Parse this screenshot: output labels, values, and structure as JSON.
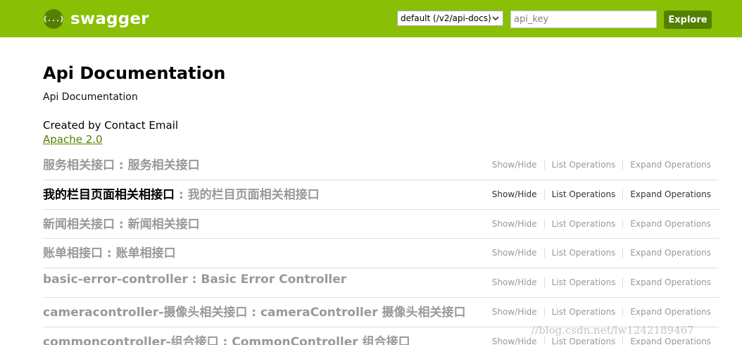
{
  "header": {
    "logo_text": "swagger",
    "logo_glyph": "{...}",
    "spec_select_value": "default (/v2/api-docs)",
    "api_key_placeholder": "api_key",
    "explore_label": "Explore"
  },
  "info": {
    "title": "Api Documentation",
    "description": "Api Documentation",
    "contact": "Created by Contact Email",
    "license": "Apache 2.0"
  },
  "resources": [
    {
      "name": "服务相关接口",
      "separator": " : ",
      "desc": "服务相关接口",
      "show_hide": "Show/Hide",
      "list_ops": "List Operations",
      "expand_ops": "Expand Operations"
    },
    {
      "name": "我的栏目页面相关相接口",
      "separator": " : ",
      "desc": "我的栏目页面相关相接口",
      "show_hide": "Show/Hide",
      "list_ops": "List Operations",
      "expand_ops": "Expand Operations"
    },
    {
      "name": "新闻相关接口",
      "separator": " : ",
      "desc": "新闻相关接口",
      "show_hide": "Show/Hide",
      "list_ops": "List Operations",
      "expand_ops": "Expand Operations"
    },
    {
      "name": "账单相接口",
      "separator": " : ",
      "desc": "账单相接口",
      "show_hide": "Show/Hide",
      "list_ops": "List Operations",
      "expand_ops": "Expand Operations"
    },
    {
      "name": "basic-error-controller",
      "separator": " : ",
      "desc": "Basic Error Controller",
      "show_hide": "Show/Hide",
      "list_ops": "List Operations",
      "expand_ops": "Expand Operations"
    },
    {
      "name": "cameracontroller-摄像头相关接口",
      "separator": " : ",
      "desc": "cameraController 摄像头相关接口",
      "show_hide": "Show/Hide",
      "list_ops": "List Operations",
      "expand_ops": "Expand Operations"
    },
    {
      "name": "commoncontroller-组合接口",
      "separator": " : ",
      "desc": "CommonController 组合接口",
      "show_hide": "Show/Hide",
      "list_ops": "List Operations",
      "expand_ops": "Expand Operations"
    }
  ],
  "watermark": "//blog.csdn.net/lw1242189467",
  "colors": {
    "header_bg": "#89bf04",
    "button_bg": "#547f00",
    "muted_text": "#999999"
  }
}
